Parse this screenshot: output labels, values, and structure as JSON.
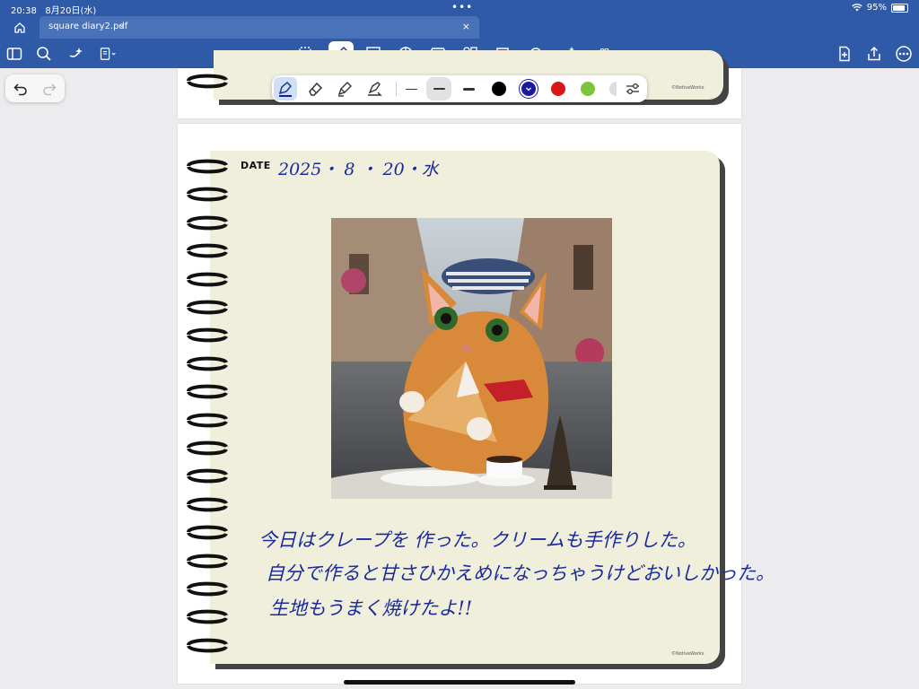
{
  "status": {
    "time": "20:38",
    "date": "8月20日(水)",
    "battery": "95%",
    "dots": "•••"
  },
  "tab": {
    "file_name": "square diary2.pdf",
    "chevron": "⌄",
    "close": "×"
  },
  "toolbar": {
    "icons": [
      "sidebar-icon",
      "search-icon",
      "sparkle-icon",
      "document-settings-icon",
      "lasso-icon",
      "pen-icon",
      "text-box-icon",
      "shapes-icon",
      "image-icon",
      "elements-icon",
      "sticky-note-icon",
      "laser-icon",
      "ai-wand-icon",
      "more-tools-icon",
      "add-page-icon",
      "share-icon",
      "more-icon"
    ]
  },
  "pen_toolbar": {
    "colors": [
      "#000000",
      "#1a1aa0",
      "#d81818",
      "#7cc43c"
    ],
    "selected_color": "#1a1aa0"
  },
  "diary": {
    "date_label": "DATE",
    "date_value": "2025・ 8 ・ 20・水",
    "credit": "©NotiveWorks",
    "lines": [
      "今日はクレープを 作った。クリームも手作りした。",
      "自分で作ると甘さひかえめになっちゃうけどおいしかった。",
      "生地もうまく焼けたよ!!"
    ]
  },
  "colors": {
    "chrome": "#2f5aa8",
    "tab": "#4a72b8",
    "paper": "#f0efdc",
    "ink": "#1a2a9c"
  }
}
